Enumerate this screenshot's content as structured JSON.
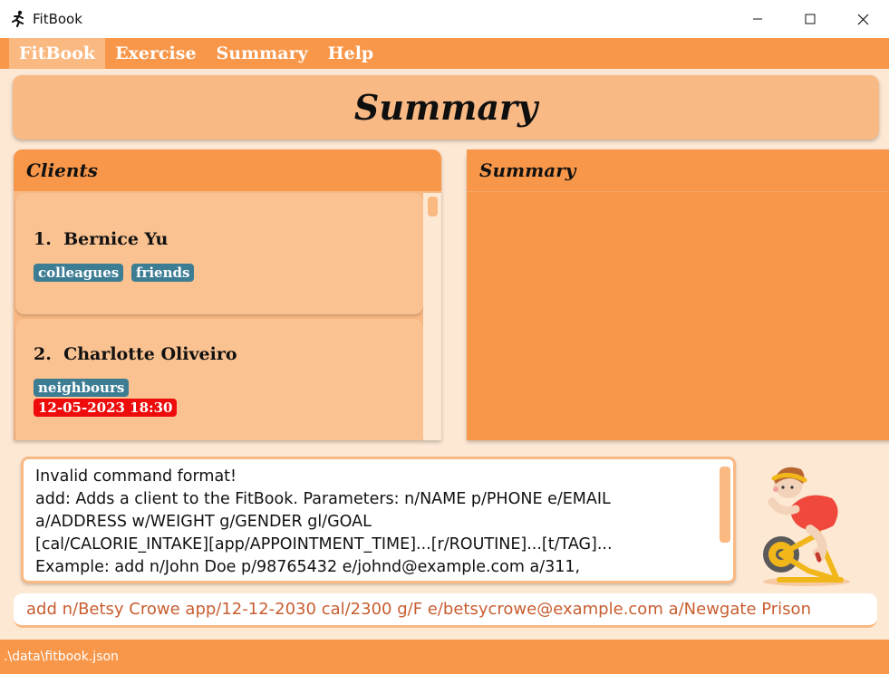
{
  "window": {
    "title": "FitBook",
    "icon": "running-person-icon",
    "controls": [
      "minimize-icon",
      "maximize-icon",
      "close-icon"
    ]
  },
  "menu": {
    "items": [
      {
        "label": "FitBook",
        "active": true
      },
      {
        "label": "Exercise",
        "active": false
      },
      {
        "label": "Summary",
        "active": false
      },
      {
        "label": "Help",
        "active": false
      }
    ]
  },
  "header": {
    "title": "Summary"
  },
  "clients_panel": {
    "title": "Clients",
    "clients": [
      {
        "index": "1.",
        "name": "Bernice Yu",
        "tags": [
          "colleagues",
          "friends"
        ],
        "appointments": []
      },
      {
        "index": "2.",
        "name": "Charlotte Oliveiro",
        "tags": [
          "neighbours"
        ],
        "appointments": [
          "12-05-2023 18:30"
        ]
      }
    ]
  },
  "summary_panel": {
    "title": "Summary"
  },
  "result": {
    "lines": [
      "Invalid command format!",
      "add: Adds a client to the FitBook. Parameters: n/NAME p/PHONE e/EMAIL",
      "a/ADDRESS w/WEIGHT g/GENDER gl/GOAL",
      "[cal/CALORIE_INTAKE][app/APPOINTMENT_TIME]...[r/ROUTINE]...[t/TAG]...",
      "Example: add n/John Doe p/98765432 e/johnd@example.com a/311,"
    ]
  },
  "command": {
    "value": "add n/Betsy Crowe app/12-12-2030 cal/2300 g/F e/betsycrowe@example.com a/Newgate Prison"
  },
  "status": {
    "path": ".\\data\\fitbook.json"
  },
  "colors": {
    "accent": "#f8974a",
    "card": "#fbc291",
    "tag_blue": "#3d7d94",
    "tag_red": "#ee0b0b",
    "background": "#fde8d4"
  }
}
